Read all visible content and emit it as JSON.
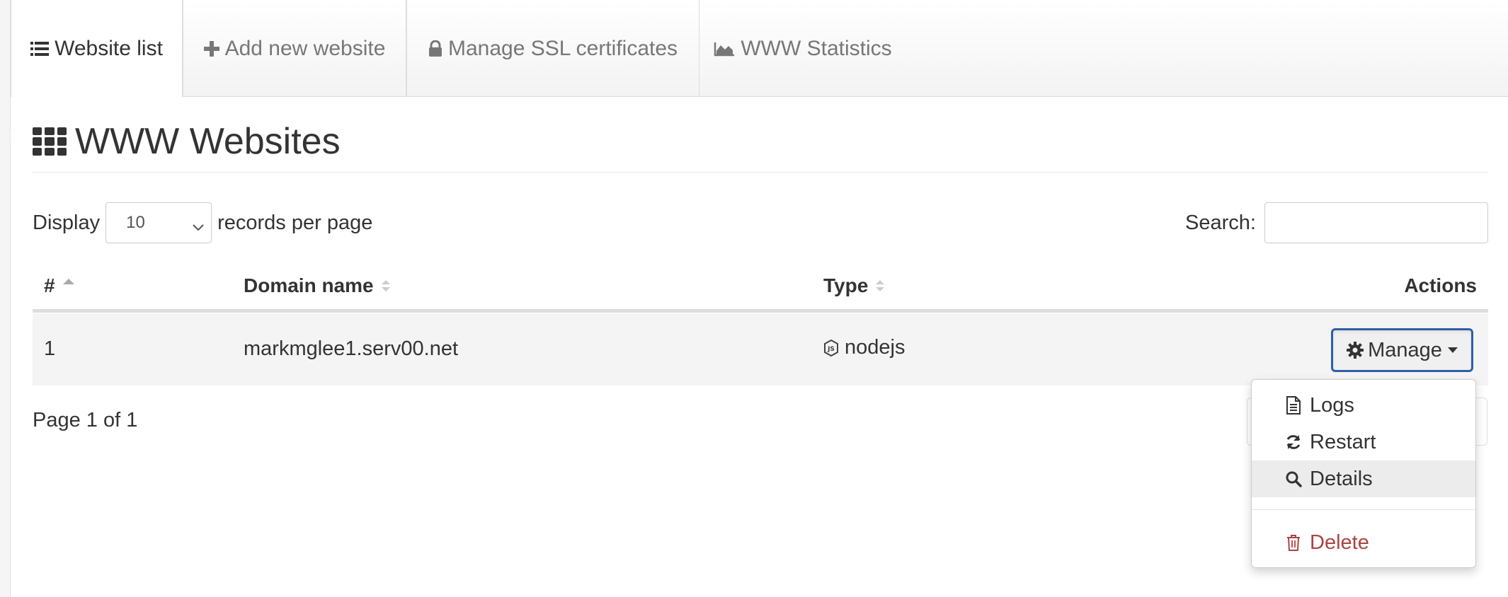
{
  "tabs": [
    {
      "label": "Website list",
      "icon": "list-icon",
      "active": true
    },
    {
      "label": "Add new website",
      "icon": "plus-icon",
      "active": false
    },
    {
      "label": "Manage SSL certificates",
      "icon": "lock-icon",
      "active": false
    },
    {
      "label": "WWW Statistics",
      "icon": "area-chart-icon",
      "active": false
    }
  ],
  "page": {
    "title": "WWW Websites",
    "title_icon": "grid-icon"
  },
  "controls": {
    "display_label": "Display",
    "page_size_value": "10",
    "records_label": "records per page",
    "search_label": "Search:",
    "search_value": ""
  },
  "table": {
    "columns": [
      "#",
      "Domain name",
      "Type",
      "Actions"
    ],
    "sort_column": "#",
    "sort_direction": "asc",
    "rows": [
      {
        "num": "1",
        "domain": "markmglee1.serv00.net",
        "type": "nodejs",
        "type_icon": "nodejs-icon",
        "action_label": "Manage"
      }
    ]
  },
  "pagination": {
    "info": "Page 1 of 1"
  },
  "dropdown": {
    "items": [
      {
        "label": "Logs",
        "icon": "file-text-icon"
      },
      {
        "label": "Restart",
        "icon": "refresh-icon"
      },
      {
        "label": "Details",
        "icon": "search-icon",
        "highlighted": true
      },
      {
        "label": "Delete",
        "icon": "trash-icon",
        "danger": true
      }
    ]
  },
  "colors": {
    "accent_border": "#2f5fa8",
    "danger": "#a94442",
    "row_bg": "#f4f4f4"
  }
}
